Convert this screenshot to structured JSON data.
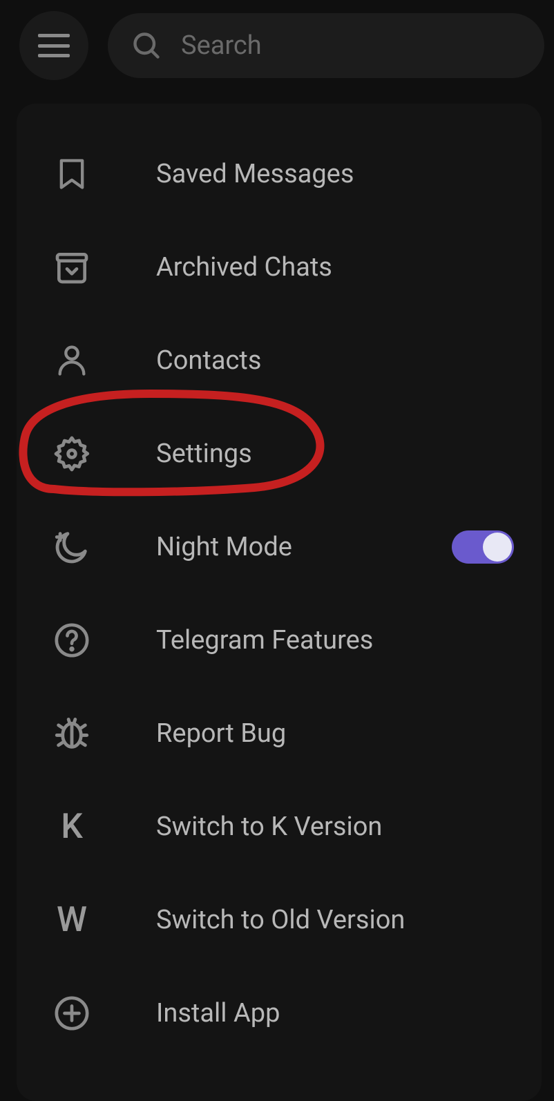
{
  "search": {
    "placeholder": "Search"
  },
  "menu": {
    "saved_messages": "Saved Messages",
    "archived_chats": "Archived Chats",
    "contacts": "Contacts",
    "settings": "Settings",
    "night_mode": "Night Mode",
    "telegram_features": "Telegram Features",
    "report_bug": "Report Bug",
    "switch_k": "Switch to K Version",
    "switch_old": "Switch to Old Version",
    "install_app": "Install App"
  },
  "night_mode_on": true,
  "letters": {
    "k": "K",
    "w": "W"
  },
  "colors": {
    "accent": "#6a5acd",
    "annotation": "#c62020"
  }
}
